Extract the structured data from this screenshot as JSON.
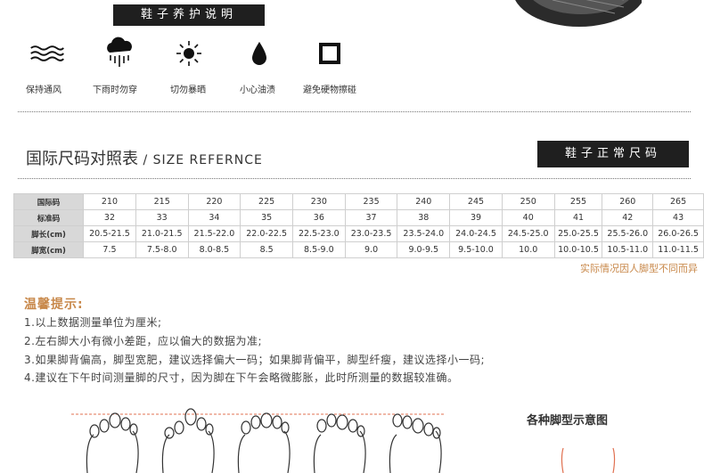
{
  "care": {
    "banner": "鞋子养护说明",
    "items": [
      {
        "icon": "wind-icon",
        "label": "保持通风"
      },
      {
        "icon": "rain-cloud-icon",
        "label": "下雨时勿穿"
      },
      {
        "icon": "sun-icon",
        "label": "切勿暴晒"
      },
      {
        "icon": "oil-drop-icon",
        "label": "小心油渍"
      },
      {
        "icon": "hard-object-square-icon",
        "label": "避免硬物擦碰"
      }
    ]
  },
  "size": {
    "title_cn": "国际尺码对照表",
    "title_en": " / SIZE REFERNCE",
    "banner": "鞋子正常尺码",
    "rows": [
      {
        "label": "国际码",
        "values": [
          "210",
          "215",
          "220",
          "225",
          "230",
          "235",
          "240",
          "245",
          "250",
          "255",
          "260",
          "265"
        ]
      },
      {
        "label": "标准码",
        "values": [
          "32",
          "33",
          "34",
          "35",
          "36",
          "37",
          "38",
          "39",
          "40",
          "41",
          "42",
          "43"
        ]
      },
      {
        "label": "脚长(cm)",
        "values": [
          "20.5-21.5",
          "21.0-21.5",
          "21.5-22.0",
          "22.0-22.5",
          "22.5-23.0",
          "23.0-23.5",
          "23.5-24.0",
          "24.0-24.5",
          "24.5-25.0",
          "25.0-25.5",
          "25.5-26.0",
          "26.0-26.5"
        ]
      },
      {
        "label": "脚宽(cm)",
        "values": [
          "7.5",
          "7.5-8.0",
          "8.0-8.5",
          "8.5",
          "8.5-9.0",
          "9.0",
          "9.0-9.5",
          "9.5-10.0",
          "10.0",
          "10.0-10.5",
          "10.5-11.0",
          "11.0-11.5"
        ]
      }
    ],
    "note": "实际情况因人脚型不同而异"
  },
  "tips": {
    "title": "温馨提示:",
    "lines": [
      "1.以上数据测量单位为厘米;",
      "2.左右脚大小有微小差距，应以偏大的数据为准;",
      "3.如果脚背偏高，脚型宽肥，建议选择偏大一码；如果脚背偏平，脚型纤瘦，建议选择小一码;",
      "4.建议在下午时间测量脚的尺寸，因为脚在下午会略微膨胀，此时所测量的数据较准确。"
    ]
  },
  "foot_types": {
    "title": "各种脚型示意图"
  },
  "colors": {
    "banner_bg": "#1f1f1f",
    "accent": "#c8884a",
    "table_head_bg": "#d8d8d8"
  }
}
